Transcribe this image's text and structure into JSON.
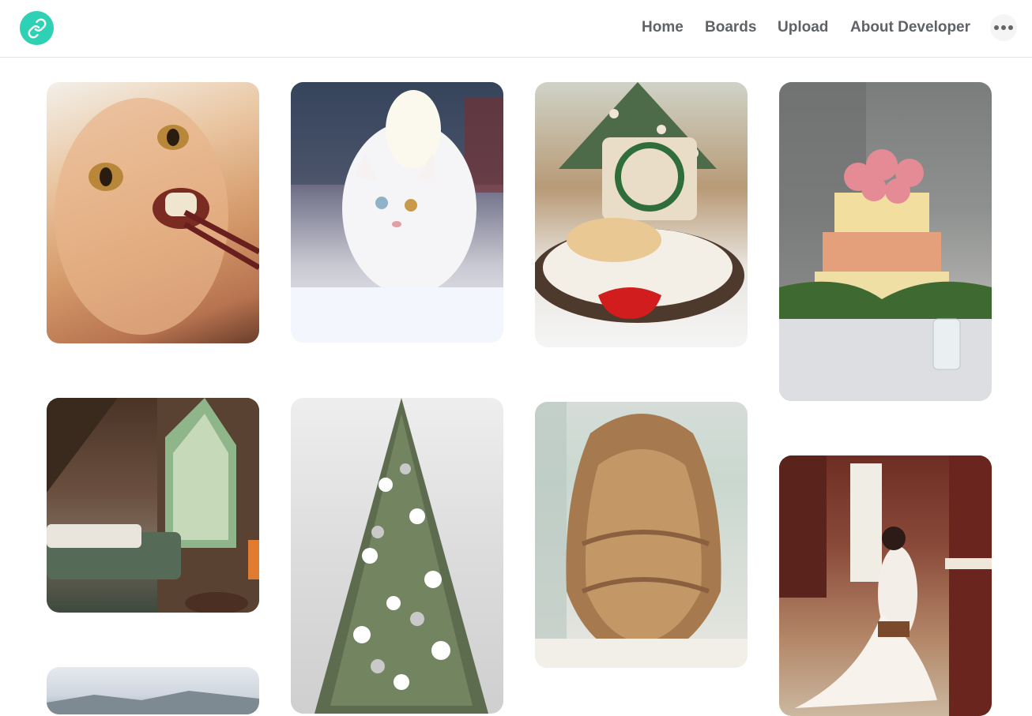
{
  "nav": {
    "home": "Home",
    "boards": "Boards",
    "upload": "Upload",
    "about": "About Developer"
  },
  "icons": {
    "logo": "link-icon",
    "more": "more-horizontal-icon"
  },
  "colors": {
    "brand": "#2fd1b4",
    "nav_text": "#5f6368"
  },
  "pins": [
    {
      "name": "pin-cat-eating"
    },
    {
      "name": "pin-white-cat-snow"
    },
    {
      "name": "pin-puppy-christmas-basket"
    },
    {
      "name": "pin-rose-wedding-cake"
    },
    {
      "name": "pin-attic-bedroom"
    },
    {
      "name": "pin-white-christmas-tree"
    },
    {
      "name": "pin-wavy-hair"
    },
    {
      "name": "pin-bride-dressing-room"
    },
    {
      "name": "pin-landscape"
    }
  ]
}
